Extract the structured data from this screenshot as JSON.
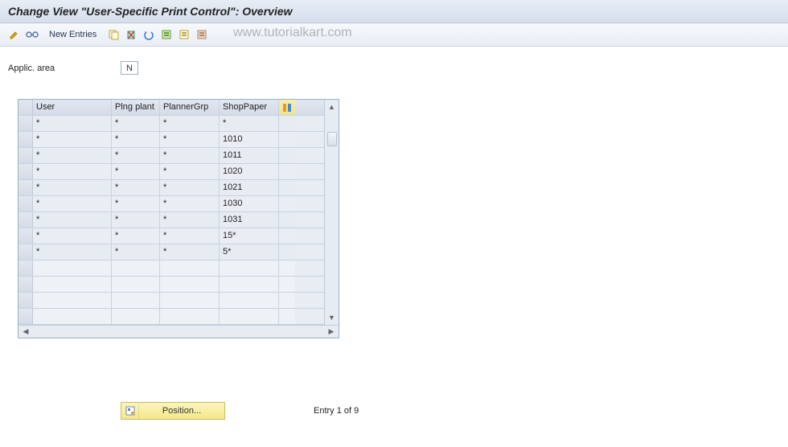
{
  "title": "Change View \"User-Specific Print Control\": Overview",
  "toolbar": {
    "new_entries_label": "New Entries"
  },
  "watermark": "www.tutorialkart.com",
  "field": {
    "label": "Applic. area",
    "value": "N"
  },
  "table": {
    "headers": {
      "user": "User",
      "plant": "Plng plant",
      "grp": "PlannerGrp",
      "paper": "ShopPaper"
    },
    "rows": [
      {
        "user": "*",
        "plant": "*",
        "grp": "*",
        "paper": "*"
      },
      {
        "user": "*",
        "plant": "*",
        "grp": "*",
        "paper": "1010"
      },
      {
        "user": "*",
        "plant": "*",
        "grp": "*",
        "paper": "1011"
      },
      {
        "user": "*",
        "plant": "*",
        "grp": "*",
        "paper": "1020"
      },
      {
        "user": "*",
        "plant": "*",
        "grp": "*",
        "paper": "1021"
      },
      {
        "user": "*",
        "plant": "*",
        "grp": "*",
        "paper": "1030"
      },
      {
        "user": "*",
        "plant": "*",
        "grp": "*",
        "paper": "1031"
      },
      {
        "user": "*",
        "plant": "*",
        "grp": "*",
        "paper": "15*"
      },
      {
        "user": "*",
        "plant": "*",
        "grp": "*",
        "paper": "5*"
      }
    ],
    "empty_rows": 4
  },
  "footer": {
    "position_label": "Position...",
    "entry_text": "Entry 1 of 9"
  }
}
